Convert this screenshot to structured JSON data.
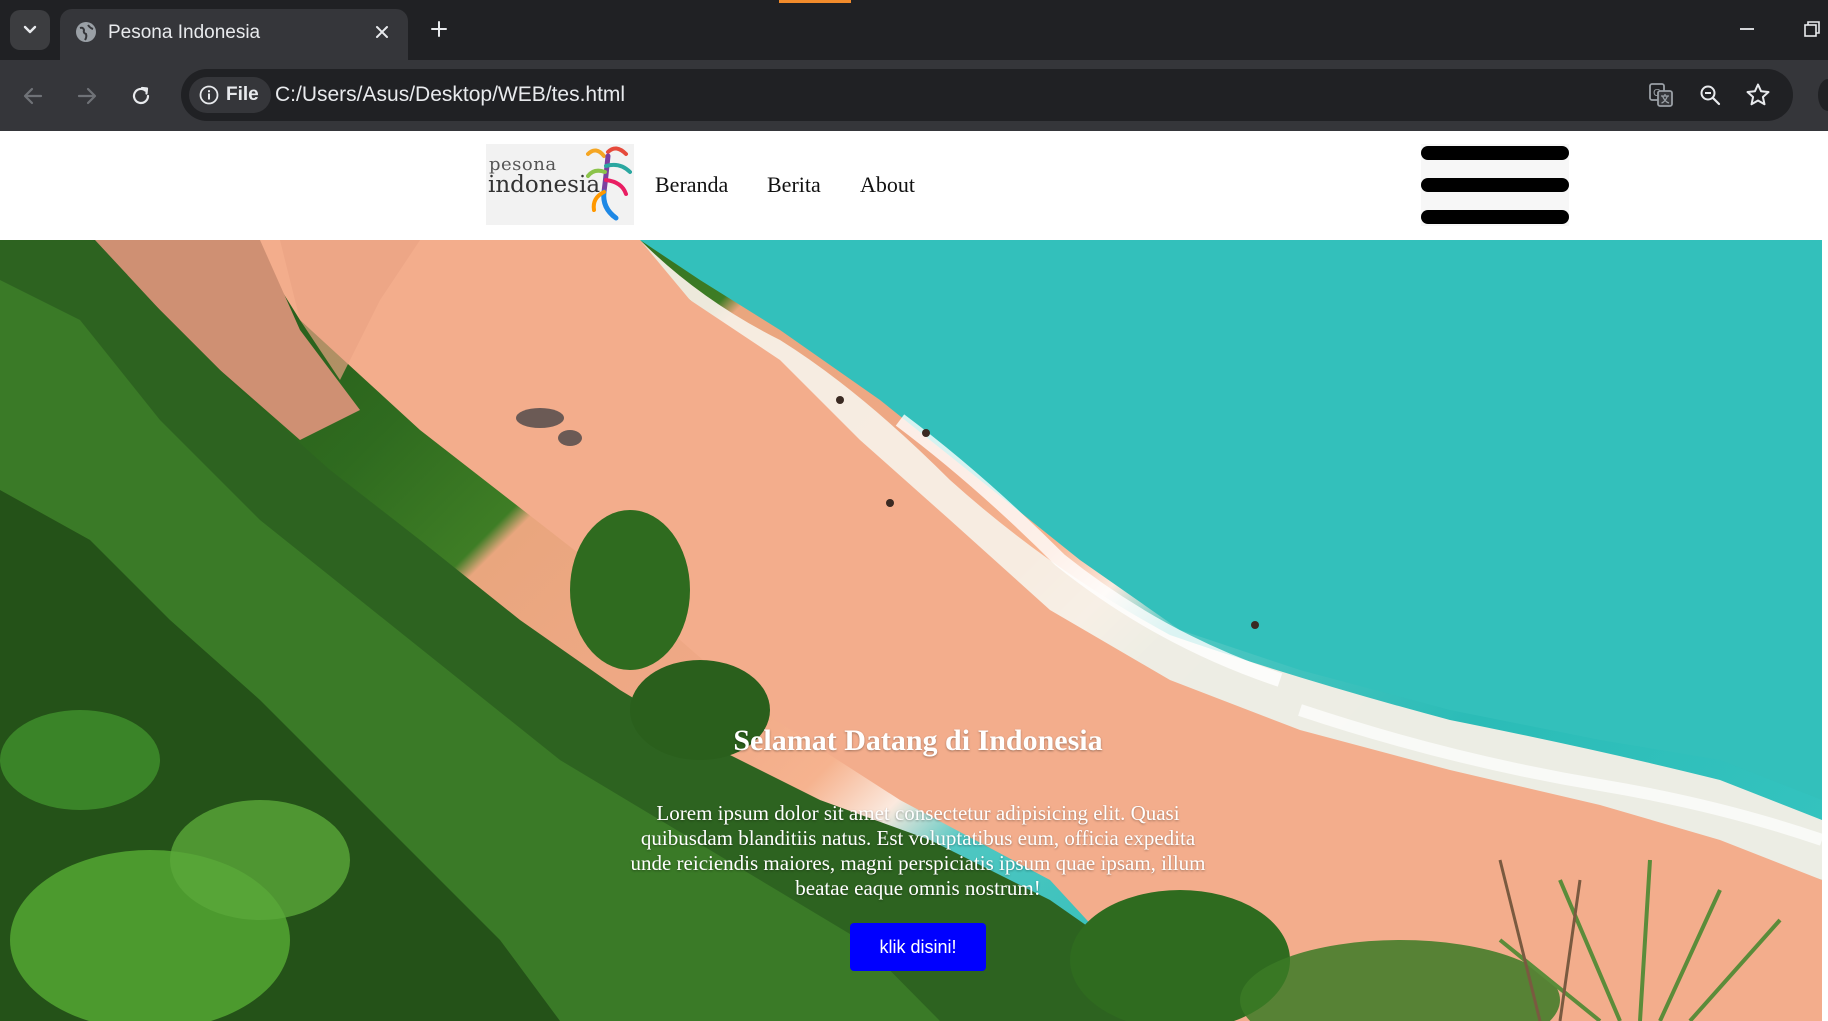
{
  "browser": {
    "tab_title": "Pesona Indonesia",
    "url_chip_label": "File",
    "url": "C:/Users/Asus/Desktop/WEB/tes.html"
  },
  "logo": {
    "line1": "pesona",
    "line2": "indonesia"
  },
  "nav": {
    "links": [
      "Beranda",
      "Berita",
      "About"
    ]
  },
  "hero": {
    "title": "Selamat Datang di Indonesia",
    "text": "Lorem ipsum dolor sit amet consectetur adipisicing elit. Quasi quibusdam blanditiis natus. Est voluptatibus eum, officia expedita unde reiciendis maiores, magni perspiciatis ipsum quae ipsam, illum beatae eaque omnis nostrum!",
    "button_label": "klik disini!",
    "button_color": "#0000ff"
  },
  "icons": {
    "tab_menu": "chevron-down-icon",
    "favicon": "globe-icon",
    "tab_close": "close-icon",
    "new_tab": "plus-icon",
    "back": "arrow-left-icon",
    "forward": "arrow-right-icon",
    "reload": "reload-icon",
    "site_info": "info-icon",
    "translate": "translate-icon",
    "zoom": "zoom-out-icon",
    "bookmark": "star-icon",
    "menu": "hamburger-icon"
  }
}
